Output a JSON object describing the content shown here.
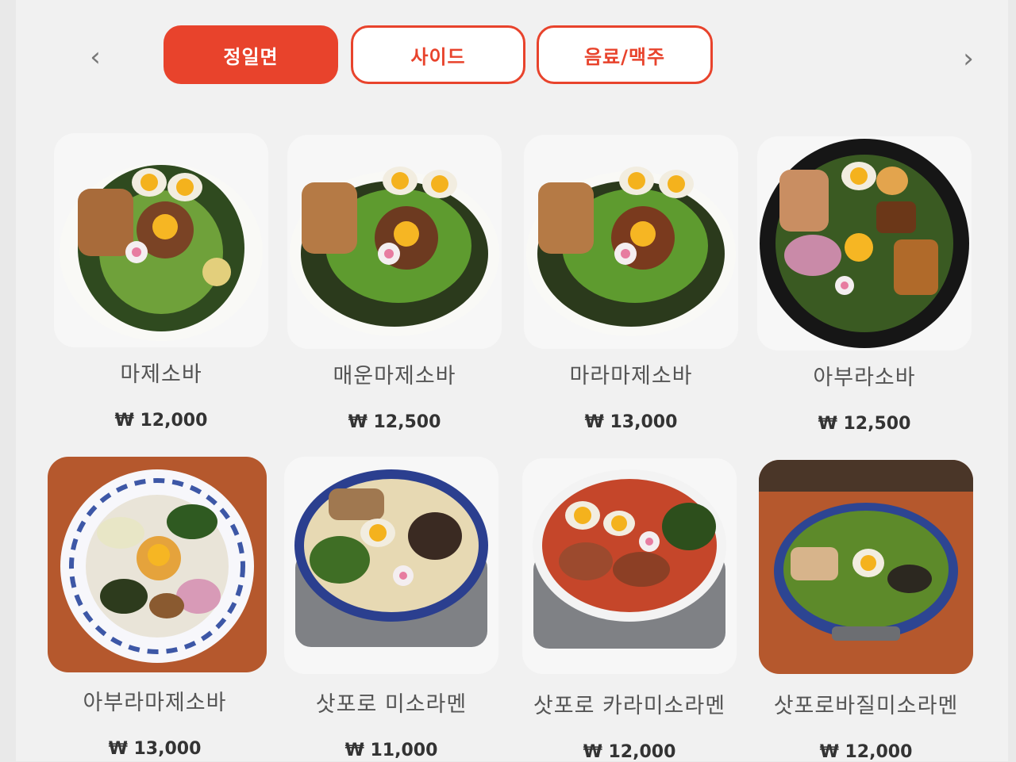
{
  "nav": {
    "prev_icon": "chevron-left-icon",
    "next_icon": "chevron-right-icon",
    "prev_glyph": "‹",
    "next_glyph": "›"
  },
  "tabs": [
    {
      "label": "정일면",
      "active": true
    },
    {
      "label": "사이드",
      "active": false
    },
    {
      "label": "음료/맥주",
      "active": false
    }
  ],
  "colors": {
    "accent": "#e8432c"
  },
  "menu": [
    {
      "name": "마제소바",
      "price": "₩ 12,000"
    },
    {
      "name": "매운마제소바",
      "price": "₩ 12,500"
    },
    {
      "name": "마라마제소바",
      "price": "₩ 13,000"
    },
    {
      "name": "아부라소바",
      "price": "₩ 12,500"
    },
    {
      "name": "아부라마제소바",
      "price": "₩ 13,000"
    },
    {
      "name": "삿포로 미소라멘",
      "price": "₩ 11,000"
    },
    {
      "name": "삿포로 카라미소라멘",
      "price": "₩ 12,000"
    },
    {
      "name": "삿포로바질미소라멘",
      "price": "₩ 12,000"
    }
  ]
}
